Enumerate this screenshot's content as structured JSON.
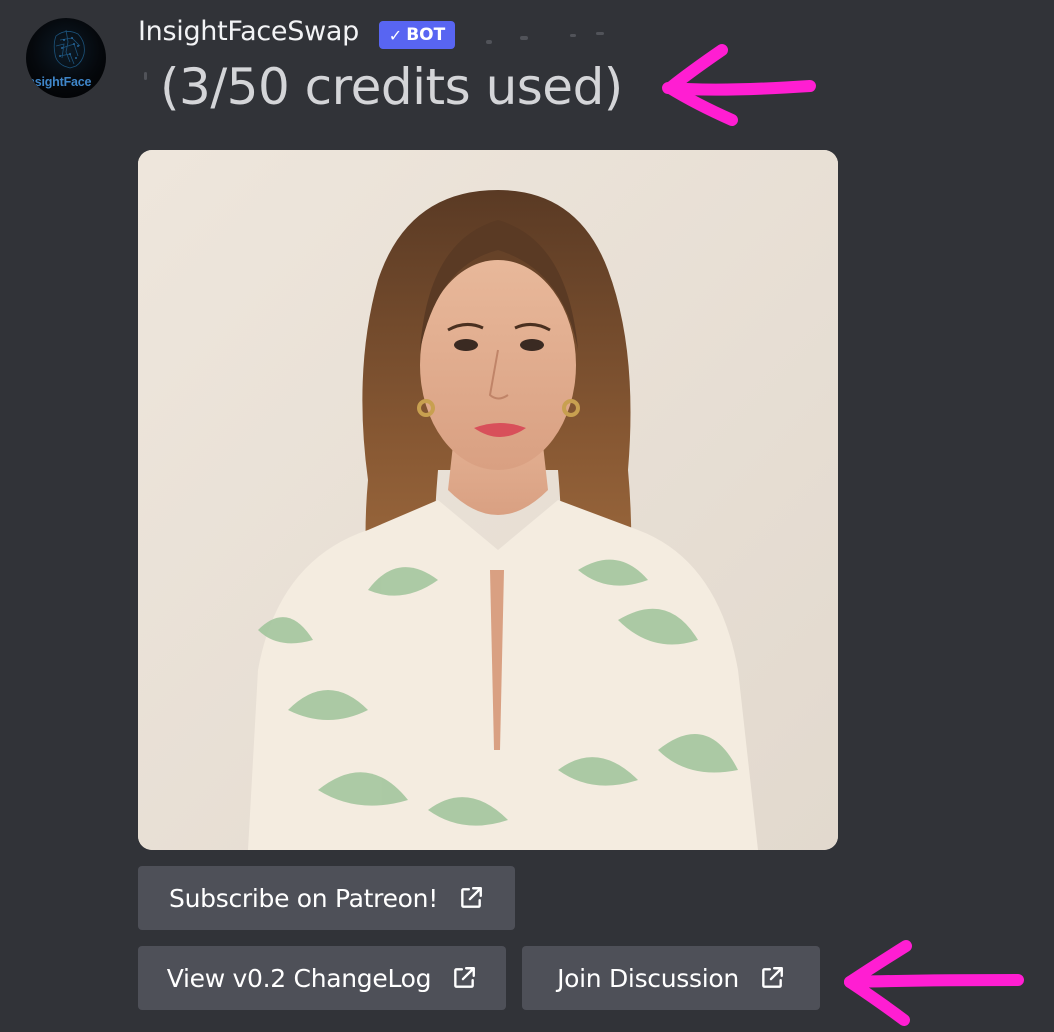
{
  "message": {
    "author": "InsightFaceSwap",
    "bot_tag": "BOT",
    "avatar_text": "InsightFace",
    "credits_text": "(3/50 credits used)"
  },
  "buttons": [
    {
      "label": "Subscribe on Patreon!",
      "icon": "external-link-icon"
    },
    {
      "label": "View v0.2 ChangeLog",
      "icon": "external-link-icon"
    },
    {
      "label": "Join Discussion",
      "icon": "external-link-icon"
    }
  ],
  "colors": {
    "background": "#313338",
    "bot_tag": "#5865f2",
    "button": "#4e5058",
    "annotation_arrow": "#ff1ed2"
  },
  "image": {
    "description_icon": "portrait-photo"
  }
}
